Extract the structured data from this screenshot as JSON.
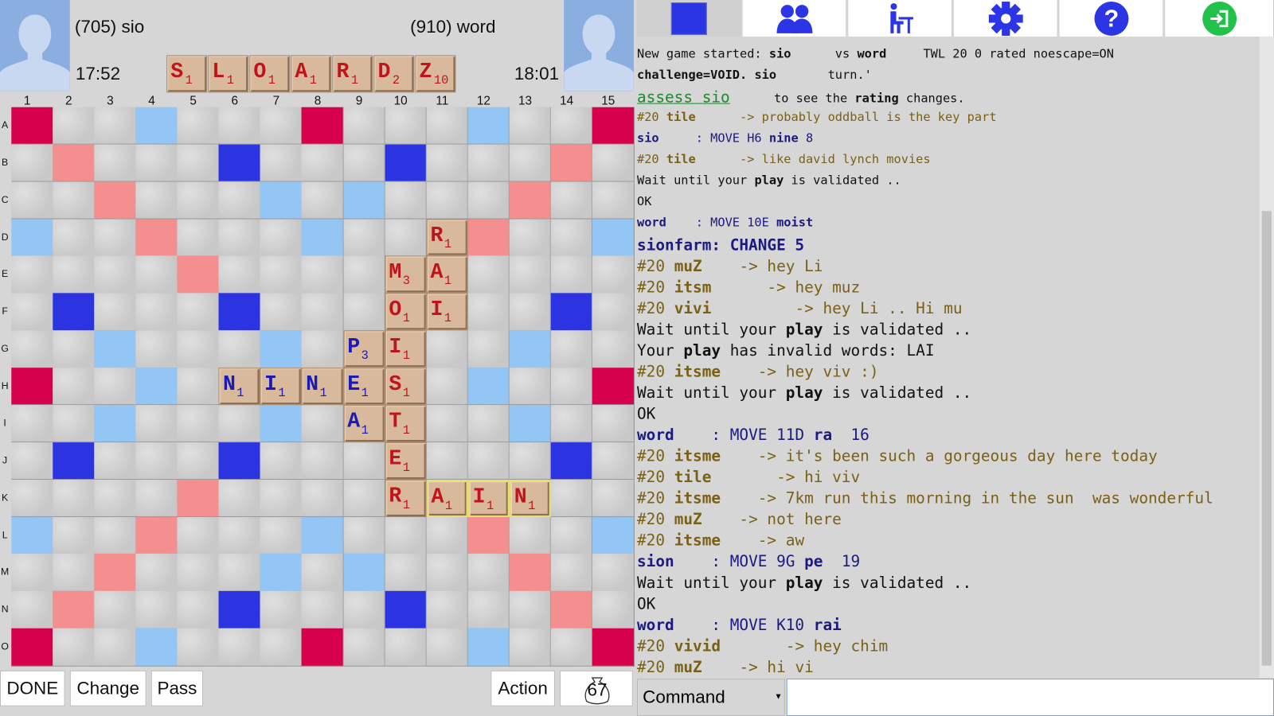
{
  "players": {
    "left": {
      "rating_name": "(705) sio",
      "timer": "17:52"
    },
    "right": {
      "rating_name": "(910) word",
      "timer": "18:01"
    }
  },
  "rack": [
    {
      "l": "S",
      "p": "1"
    },
    {
      "l": "L",
      "p": "1"
    },
    {
      "l": "O",
      "p": "1"
    },
    {
      "l": "A",
      "p": "1"
    },
    {
      "l": "R",
      "p": "1"
    },
    {
      "l": "D",
      "p": "2"
    },
    {
      "l": "Z",
      "p": "10"
    }
  ],
  "board": {
    "columns": [
      "1",
      "2",
      "3",
      "4",
      "5",
      "6",
      "7",
      "8",
      "9",
      "10",
      "11",
      "12",
      "13",
      "14",
      "15"
    ],
    "rows": [
      "A",
      "B",
      "C",
      "D",
      "E",
      "F",
      "G",
      "H",
      "I",
      "J",
      "K",
      "L",
      "M",
      "N",
      "O"
    ],
    "premium": [
      "W..l...W...l..W",
      ".w...t...t...w.",
      "..w...l.l...w..",
      "l..w...l...w..l",
      "....w.....w....",
      ".t...t...t...t.",
      "..l...l.l...l..",
      "W..l...w...l..W",
      "..l...l.l...l..",
      ".t...t...t...t.",
      "....w.....w....",
      "l..w...l...w..l",
      "..w...l.l...w..",
      ".w...t...t...w.",
      "W..l...W...l..W"
    ],
    "premium_colors": {
      "triple_word": "#d6004c",
      "double_word": "#f58e8e",
      "triple_letter": "#2b34e0",
      "double_letter": "#94c6f5"
    },
    "tiles": [
      {
        "r": 3,
        "c": 10,
        "l": "R",
        "p": "1",
        "player": "red"
      },
      {
        "r": 4,
        "c": 9,
        "l": "M",
        "p": "3",
        "player": "red"
      },
      {
        "r": 4,
        "c": 10,
        "l": "A",
        "p": "1",
        "player": "red"
      },
      {
        "r": 5,
        "c": 9,
        "l": "O",
        "p": "1",
        "player": "red"
      },
      {
        "r": 5,
        "c": 10,
        "l": "I",
        "p": "1",
        "player": "red"
      },
      {
        "r": 6,
        "c": 8,
        "l": "P",
        "p": "3",
        "player": "blue"
      },
      {
        "r": 6,
        "c": 9,
        "l": "I",
        "p": "1",
        "player": "red"
      },
      {
        "r": 7,
        "c": 5,
        "l": "N",
        "p": "1",
        "player": "blue"
      },
      {
        "r": 7,
        "c": 6,
        "l": "I",
        "p": "1",
        "player": "blue"
      },
      {
        "r": 7,
        "c": 7,
        "l": "N",
        "p": "1",
        "player": "blue"
      },
      {
        "r": 7,
        "c": 8,
        "l": "E",
        "p": "1",
        "player": "blue"
      },
      {
        "r": 7,
        "c": 9,
        "l": "S",
        "p": "1",
        "player": "red"
      },
      {
        "r": 8,
        "c": 8,
        "l": "A",
        "p": "1",
        "player": "blue"
      },
      {
        "r": 8,
        "c": 9,
        "l": "T",
        "p": "1",
        "player": "red"
      },
      {
        "r": 9,
        "c": 9,
        "l": "E",
        "p": "1",
        "player": "red"
      },
      {
        "r": 10,
        "c": 9,
        "l": "R",
        "p": "1",
        "player": "red"
      },
      {
        "r": 10,
        "c": 10,
        "l": "A",
        "p": "1",
        "player": "red",
        "last": true
      },
      {
        "r": 10,
        "c": 11,
        "l": "I",
        "p": "1",
        "player": "red",
        "last": true
      },
      {
        "r": 10,
        "c": 12,
        "l": "N",
        "p": "1",
        "player": "red",
        "last": true
      }
    ]
  },
  "buttons": {
    "done": "DONE",
    "change": "Change",
    "pass": "Pass",
    "action": "Action",
    "bag_count": "67"
  },
  "toolbar": [
    "board-icon",
    "players-icon",
    "seat-icon",
    "gear-icon",
    "help-icon",
    "exit-icon"
  ],
  "chat": {
    "lines": [
      {
        "sz": "s",
        "segs": [
          {
            "t": "New game started: ",
            "c": "k"
          },
          {
            "t": "sio",
            "c": "k",
            "b": 1
          },
          {
            "t": "      vs ",
            "c": "k"
          },
          {
            "t": "word",
            "c": "k",
            "b": 1
          },
          {
            "t": "     TWL 20 0 rated noescape=ON",
            "c": "k"
          }
        ]
      },
      {
        "sz": "s",
        "segs": [
          {
            "t": "challenge=VOID. ",
            "c": "k",
            "b": 1
          },
          {
            "t": "sio",
            "c": "k",
            "b": 1
          },
          {
            "t": "       turn.'",
            "c": "k"
          }
        ]
      },
      {
        "sz": "l",
        "segs": [
          {
            "t": "assess sio",
            "c": "g"
          },
          {
            "t": "      to see the ",
            "c": "k",
            "small": 1
          },
          {
            "t": "rating",
            "c": "k",
            "b": 1,
            "small": 1
          },
          {
            "t": " changes.",
            "c": "k",
            "small": 1
          }
        ]
      },
      {
        "sz": "s",
        "segs": [
          {
            "t": "#20 ",
            "c": "o"
          },
          {
            "t": "tile",
            "c": "o",
            "b": 1
          },
          {
            "t": "      -> probably oddball is the key part",
            "c": "o"
          }
        ]
      },
      {
        "sz": "s",
        "segs": [
          {
            "t": "sio",
            "c": "m",
            "b": 1
          },
          {
            "t": "     : MOVE H6 ",
            "c": "m"
          },
          {
            "t": "nine",
            "c": "m",
            "b": 1
          },
          {
            "t": " 8",
            "c": "m"
          }
        ]
      },
      {
        "sz": "s",
        "segs": [
          {
            "t": "#20 ",
            "c": "o"
          },
          {
            "t": "tile",
            "c": "o",
            "b": 1
          },
          {
            "t": "      -> like david lynch movies",
            "c": "o"
          }
        ]
      },
      {
        "sz": "s",
        "segs": [
          {
            "t": "Wait until your ",
            "c": "k"
          },
          {
            "t": "play",
            "c": "k",
            "b": 1
          },
          {
            "t": " is validated ..",
            "c": "k"
          }
        ]
      },
      {
        "sz": "s",
        "segs": [
          {
            "t": "OK",
            "c": "k"
          }
        ]
      },
      {
        "sz": "s",
        "segs": [
          {
            "t": "word",
            "c": "m",
            "b": 1
          },
          {
            "t": "    : MOVE 10E ",
            "c": "m"
          },
          {
            "t": "moist",
            "c": "m",
            "b": 1
          }
        ]
      },
      {
        "sz": "l",
        "segs": [
          {
            "t": "sionfarm: CHANGE 5",
            "c": "m",
            "b": 1
          }
        ]
      },
      {
        "sz": "l",
        "segs": [
          {
            "t": "#20 ",
            "c": "o"
          },
          {
            "t": "muZ",
            "c": "o",
            "b": 1
          },
          {
            "t": "    -> hey Li",
            "c": "o"
          }
        ]
      },
      {
        "sz": "l",
        "segs": [
          {
            "t": "#20 ",
            "c": "o"
          },
          {
            "t": "itsm",
            "c": "o",
            "b": 1
          },
          {
            "t": "      -> hey muz",
            "c": "o"
          }
        ]
      },
      {
        "sz": "l",
        "segs": [
          {
            "t": "#20 ",
            "c": "o"
          },
          {
            "t": "vivi",
            "c": "o",
            "b": 1
          },
          {
            "t": "         -> hey Li .. Hi mu",
            "c": "o"
          }
        ]
      },
      {
        "sz": "l",
        "segs": [
          {
            "t": "Wait until your ",
            "c": "k"
          },
          {
            "t": "play",
            "c": "k",
            "b": 1
          },
          {
            "t": " is validated ..",
            "c": "k"
          }
        ]
      },
      {
        "sz": "l",
        "segs": [
          {
            "t": "Your ",
            "c": "k"
          },
          {
            "t": "play",
            "c": "k",
            "b": 1
          },
          {
            "t": " has invalid words: LAI",
            "c": "k"
          }
        ]
      },
      {
        "sz": "l",
        "segs": [
          {
            "t": "#20 ",
            "c": "o"
          },
          {
            "t": "itsme",
            "c": "o",
            "b": 1
          },
          {
            "t": "    -> hey viv :)",
            "c": "o"
          }
        ]
      },
      {
        "sz": "l",
        "segs": [
          {
            "t": "Wait until your ",
            "c": "k"
          },
          {
            "t": "play",
            "c": "k",
            "b": 1
          },
          {
            "t": " is validated ..",
            "c": "k"
          }
        ]
      },
      {
        "sz": "l",
        "segs": [
          {
            "t": "OK",
            "c": "k"
          }
        ]
      },
      {
        "sz": "l",
        "segs": [
          {
            "t": "word",
            "c": "m",
            "b": 1
          },
          {
            "t": "    : MOVE 11D ",
            "c": "m"
          },
          {
            "t": "ra",
            "c": "m",
            "b": 1
          },
          {
            "t": "  16",
            "c": "m"
          }
        ]
      },
      {
        "sz": "l",
        "segs": [
          {
            "t": "#20 ",
            "c": "o"
          },
          {
            "t": "itsme",
            "c": "o",
            "b": 1
          },
          {
            "t": "    -> it's been such a gorgeous day here today",
            "c": "o"
          }
        ]
      },
      {
        "sz": "l",
        "segs": [
          {
            "t": "#20 ",
            "c": "o"
          },
          {
            "t": "tile",
            "c": "o",
            "b": 1
          },
          {
            "t": "       -> hi viv",
            "c": "o"
          }
        ]
      },
      {
        "sz": "l",
        "segs": [
          {
            "t": "#20 ",
            "c": "o"
          },
          {
            "t": "itsme",
            "c": "o",
            "b": 1
          },
          {
            "t": "    -> 7km run this morning in the sun  was wonderful",
            "c": "o"
          }
        ]
      },
      {
        "sz": "l",
        "segs": [
          {
            "t": "#20 ",
            "c": "o"
          },
          {
            "t": "muZ",
            "c": "o",
            "b": 1
          },
          {
            "t": "    -> not here",
            "c": "o"
          }
        ]
      },
      {
        "sz": "l",
        "segs": [
          {
            "t": "#20 ",
            "c": "o"
          },
          {
            "t": "itsme",
            "c": "o",
            "b": 1
          },
          {
            "t": "    -> aw",
            "c": "o"
          }
        ]
      },
      {
        "sz": "l",
        "segs": [
          {
            "t": "sion",
            "c": "m",
            "b": 1
          },
          {
            "t": "    : MOVE 9G ",
            "c": "m"
          },
          {
            "t": "pe",
            "c": "m",
            "b": 1
          },
          {
            "t": "  19",
            "c": "m"
          }
        ]
      },
      {
        "sz": "l",
        "segs": [
          {
            "t": "Wait until your ",
            "c": "k"
          },
          {
            "t": "play",
            "c": "k",
            "b": 1
          },
          {
            "t": " is validated ..",
            "c": "k"
          }
        ]
      },
      {
        "sz": "l",
        "segs": [
          {
            "t": "OK",
            "c": "k"
          }
        ]
      },
      {
        "sz": "l",
        "segs": [
          {
            "t": "word",
            "c": "m",
            "b": 1
          },
          {
            "t": "    : MOVE K10 ",
            "c": "m"
          },
          {
            "t": "rai",
            "c": "m",
            "b": 1
          }
        ]
      },
      {
        "sz": "l",
        "segs": [
          {
            "t": "#20 ",
            "c": "o"
          },
          {
            "t": "vivid",
            "c": "o",
            "b": 1
          },
          {
            "t": "       -> hey chim",
            "c": "o"
          }
        ]
      },
      {
        "sz": "l",
        "segs": [
          {
            "t": "#20 ",
            "c": "o"
          },
          {
            "t": "muZ",
            "c": "o",
            "b": 1
          },
          {
            "t": "    -> hi vi",
            "c": "o"
          }
        ]
      }
    ]
  },
  "command": {
    "selected": "Command",
    "input_value": ""
  }
}
